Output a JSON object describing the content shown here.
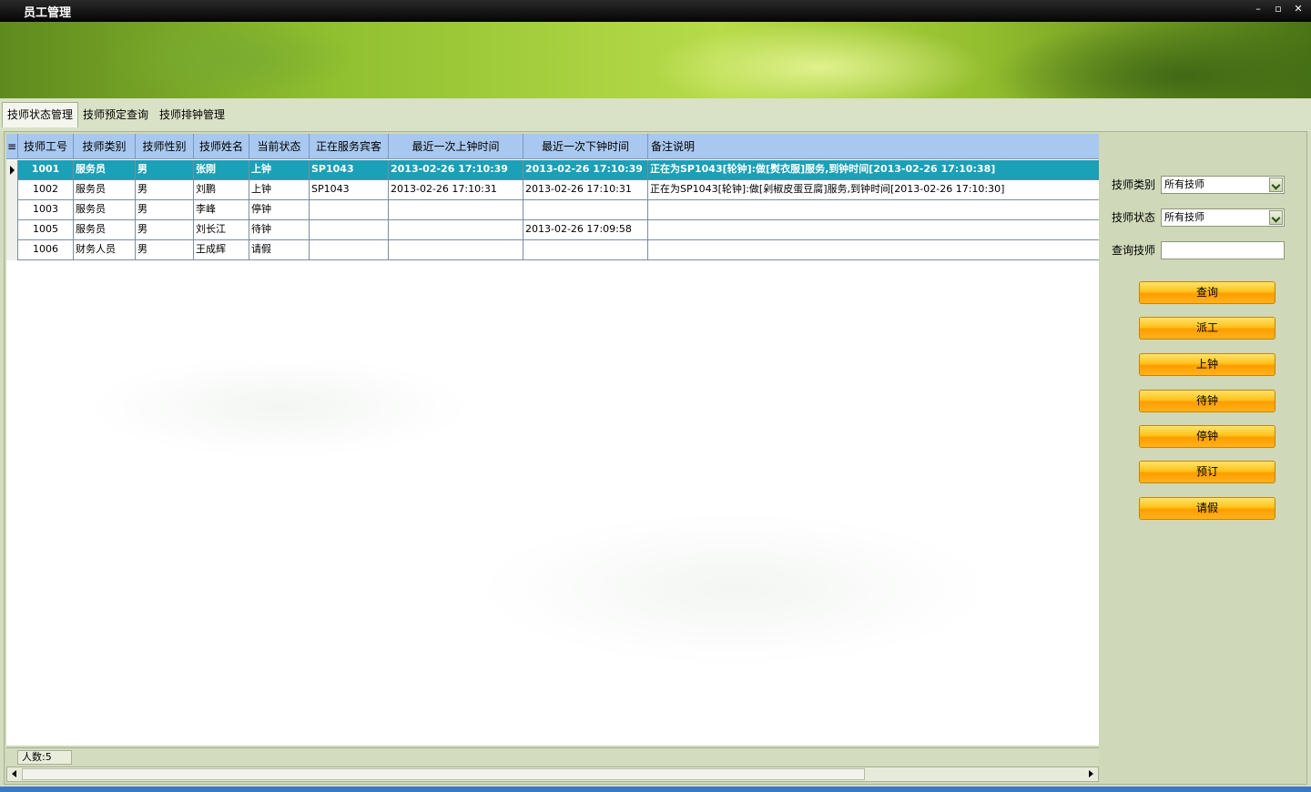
{
  "window": {
    "title": "员工管理",
    "controls": [
      "–",
      "▫",
      "✕"
    ]
  },
  "tabs": [
    {
      "label": "技师状态管理",
      "active": true
    },
    {
      "label": "技师预定查询",
      "active": false
    },
    {
      "label": "技师排钟管理",
      "active": false
    }
  ],
  "table": {
    "columns": [
      "技师工号",
      "技师类别",
      "技师性别",
      "技师姓名",
      "当前状态",
      "正在服务宾客",
      "最近一次上钟时间",
      "最近一次下钟时间",
      "备注说明"
    ],
    "rows": [
      [
        "1001",
        "服务员",
        "男",
        "张刚",
        "上钟",
        "SP1043",
        "2013-02-26 17:10:39",
        "2013-02-26 17:10:39",
        "正在为SP1043[轮钟]:做[熨衣服]服务,到钟时间[2013-02-26 17:10:38]"
      ],
      [
        "1002",
        "服务员",
        "男",
        "刘鹏",
        "上钟",
        "SP1043",
        "2013-02-26 17:10:31",
        "2013-02-26 17:10:31",
        "正在为SP1043[轮钟]:做[剁椒皮蛋豆腐]服务,到钟时间[2013-02-26 17:10:30]"
      ],
      [
        "1003",
        "服务员",
        "男",
        "李峰",
        "停钟",
        "",
        "",
        "",
        ""
      ],
      [
        "1005",
        "服务员",
        "男",
        "刘长江",
        "待钟",
        "",
        "",
        "2013-02-26 17:09:58",
        ""
      ],
      [
        "1006",
        "财务人员",
        "男",
        "王成辉",
        "请假",
        "",
        "",
        "",
        ""
      ]
    ],
    "selected_row": 0
  },
  "status": {
    "count": "人数:5"
  },
  "filters": {
    "category_label": "技师类别",
    "category_value": "所有技师",
    "state_label": "技师状态",
    "state_value": "所有技师",
    "search_label": "查询技师",
    "search_value": ""
  },
  "buttons": {
    "query": "查询",
    "dispatch": "派工",
    "start": "上钟",
    "wait": "待钟",
    "stop": "停钟",
    "reserve": "预订",
    "leave": "请假"
  },
  "colors": {
    "selected_row": "#1aa0b7",
    "header": "#a9c8ef",
    "button": "#ffb21f"
  }
}
